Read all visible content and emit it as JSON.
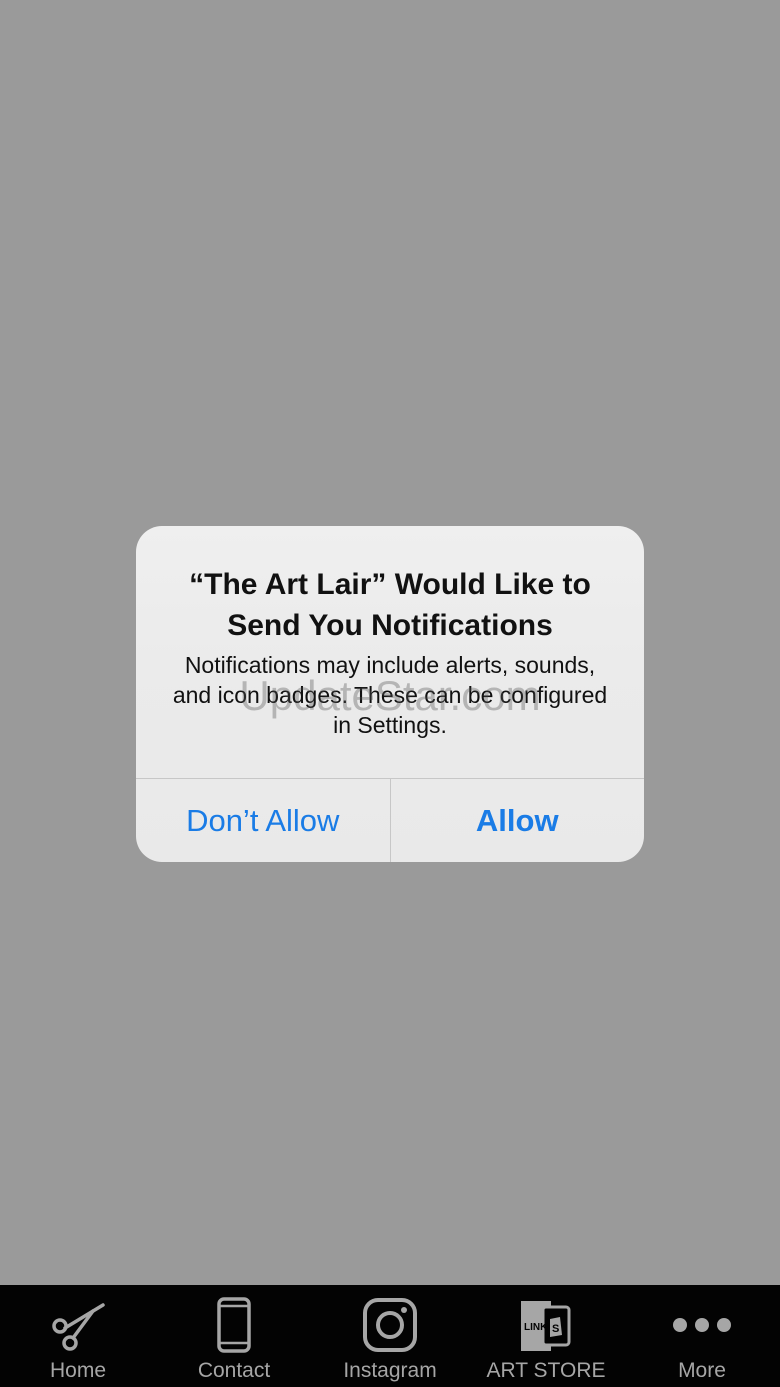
{
  "alert": {
    "title": "“The Art Lair” Would Like to Send You Notifications",
    "message": "Notifications may include alerts, sounds, and icon badges. These can be configured in Settings.",
    "dont_allow_label": "Don’t Allow",
    "allow_label": "Allow"
  },
  "watermark": {
    "text": "UpdateStar.com"
  },
  "tabbar": {
    "items": [
      {
        "label": "Home",
        "icon": "scissors-icon"
      },
      {
        "label": "Contact",
        "icon": "phone-icon"
      },
      {
        "label": "Instagram",
        "icon": "instagram-icon"
      },
      {
        "label": "ART STORE",
        "icon": "shopify-link-icon"
      },
      {
        "label": "More",
        "icon": "more-dots-icon"
      }
    ]
  },
  "colors": {
    "background": "#9a9a9a",
    "alert_background": "#ececec",
    "button_blue": "#1a7ce6",
    "tabbar_background": "#030303",
    "tab_label": "#a6a6a6"
  }
}
